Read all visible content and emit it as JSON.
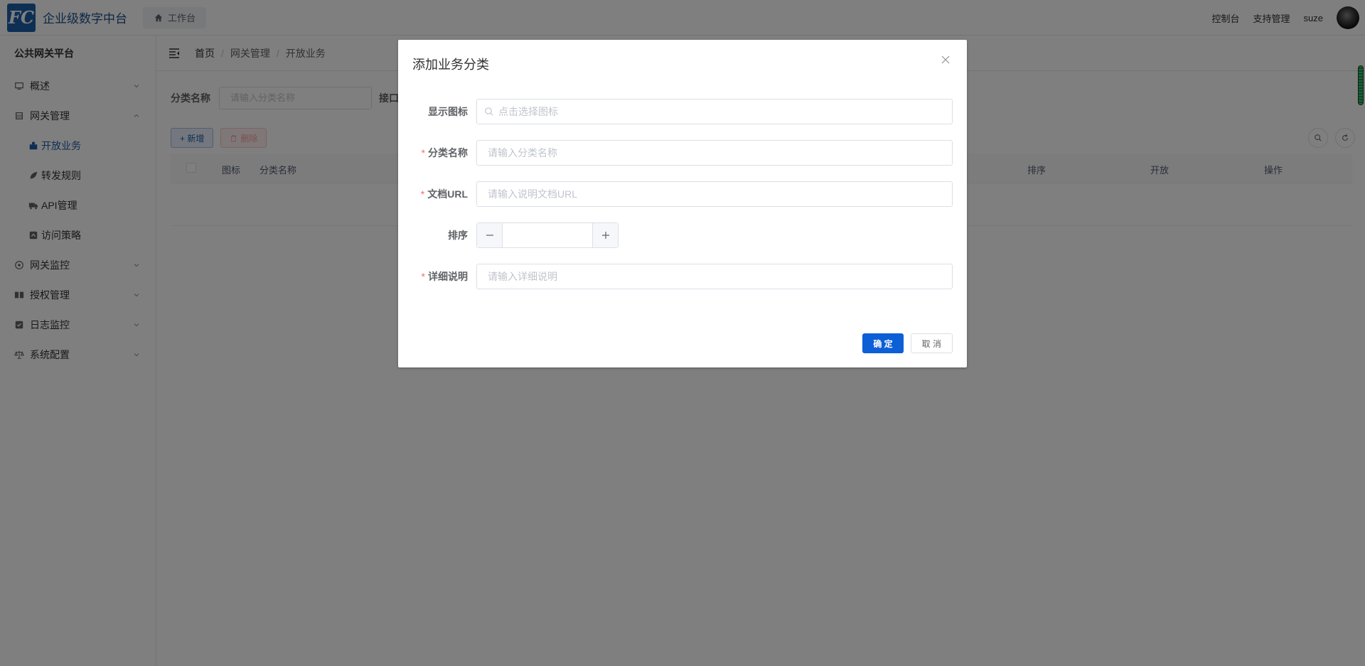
{
  "header": {
    "logo_text": "FC",
    "brand": "企业级数字中台",
    "work_tab": "工作台",
    "links": [
      "控制台",
      "支持管理",
      "suze"
    ]
  },
  "sidebar": {
    "title": "公共网关平台",
    "items": [
      {
        "label": "概述",
        "icon": "monitor-icon"
      },
      {
        "label": "网关管理",
        "icon": "layers-icon",
        "expanded": true
      },
      {
        "label": "网关监控",
        "icon": "target-icon"
      },
      {
        "label": "授权管理",
        "icon": "book-icon"
      },
      {
        "label": "日志监控",
        "icon": "checkbox-icon"
      },
      {
        "label": "系统配置",
        "icon": "scale-icon"
      }
    ],
    "sub_items": [
      {
        "label": "开放业务",
        "icon": "briefcase-icon",
        "active": true
      },
      {
        "label": "转发规则",
        "icon": "leaf-icon"
      },
      {
        "label": "API管理",
        "icon": "truck-icon"
      },
      {
        "label": "访问策略",
        "icon": "policy-icon"
      }
    ]
  },
  "breadcrumb": [
    "首页",
    "网关管理",
    "开放业务"
  ],
  "search": {
    "label": "分类名称",
    "placeholder": "请输入分类名称",
    "api_label": "接口"
  },
  "toolbar": {
    "add_label": "+ 新增",
    "delete_label": "删除"
  },
  "table": {
    "columns": [
      "图标",
      "分类名称",
      "排序",
      "开放",
      "操作"
    ]
  },
  "dialog": {
    "title": "添加业务分类",
    "fields": [
      {
        "label": "显示图标",
        "required": false,
        "placeholder": "点击选择图标"
      },
      {
        "label": "分类名称",
        "required": true,
        "placeholder": "请输入分类名称"
      },
      {
        "label": "文档URL",
        "required": true,
        "placeholder": "请输入说明文档URL"
      },
      {
        "label": "排序",
        "required": false,
        "placeholder": ""
      },
      {
        "label": "详细说明",
        "required": true,
        "placeholder": "请输入详细说明"
      }
    ],
    "confirm_label": "确 定",
    "cancel_label": "取 消",
    "required_mark": "*"
  },
  "colors": {
    "brand": "#1c5fa8",
    "primary_button": "#0d5fd6",
    "required": "#f56c6c",
    "overlay": "rgba(0,0,0,0.5)"
  }
}
